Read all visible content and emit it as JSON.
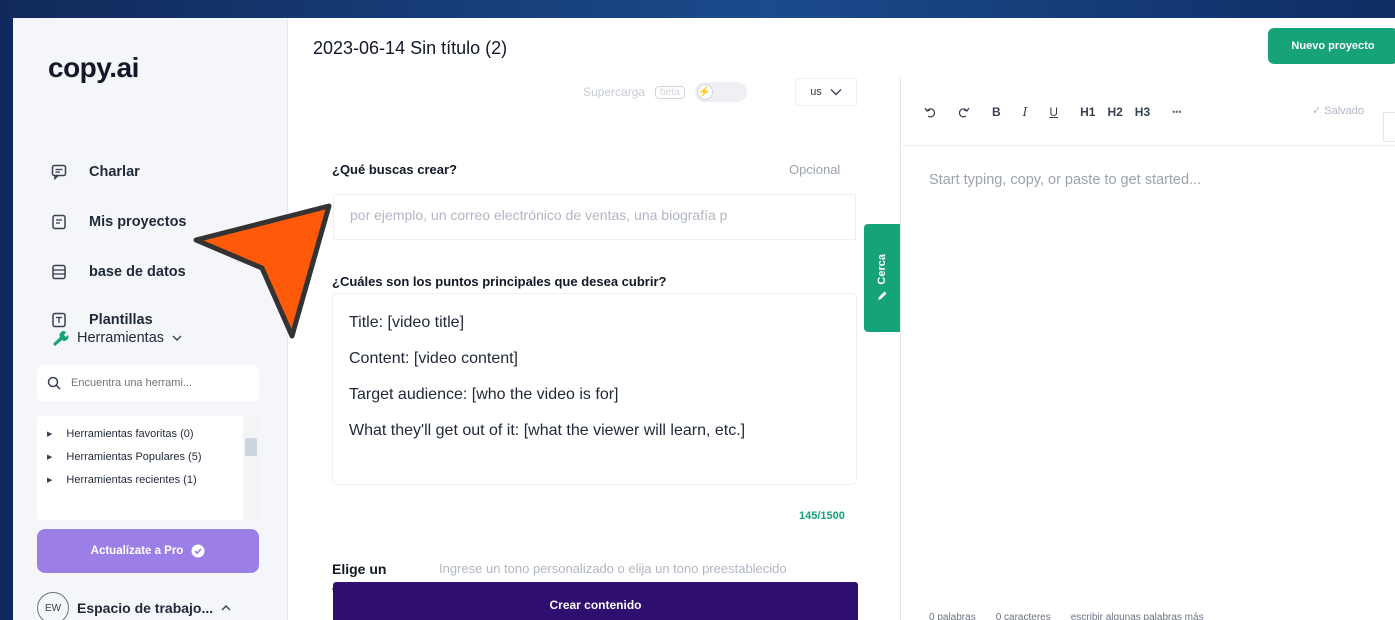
{
  "app": {
    "logo": "copy.ai",
    "doc_title": "2023-06-14 Sin título (2)",
    "new_project_label": "Nuevo proyecto"
  },
  "sidebar": {
    "items": [
      {
        "label": "Charlar",
        "icon": "chat-icon"
      },
      {
        "label": "Mis proyectos",
        "icon": "file-icon"
      },
      {
        "label": "base de datos",
        "icon": "database-icon"
      },
      {
        "label": "Plantillas",
        "icon": "template-icon"
      }
    ],
    "tools_label": "Herramientas",
    "search_placeholder": "Encuentra una herrami...",
    "tree": [
      "Herramientas favoritas (0)",
      "Herramientas Populares (5)",
      "Herramientas recientes (1)"
    ],
    "upgrade_label": "Actualízate a Pro",
    "workspace_avatar": "EW",
    "workspace_name": "Espacio de trabajo..."
  },
  "form": {
    "supercharge_label": "Supercarga",
    "beta_label": "beta",
    "language": "us",
    "q1_label": "¿Qué buscas crear?",
    "q1_optional": "Opcional",
    "q1_placeholder": "por ejemplo, un correo electrónico de ventas, una biografía p",
    "q2_label": "¿Cuáles son los puntos principales que desea cubrir?",
    "q2_lines": [
      "Title: [video title]",
      "Content: [video content]",
      "Target audience: [who the video is for]",
      "What they'll get out of it: [what the viewer will learn, etc.]"
    ],
    "counter": "145/1500",
    "tone_label": "Elige un tono",
    "tone_placeholder": "Ingrese un tono personalizado o elija un tono preestablecido",
    "create_label": "Crear contenido",
    "side_tab_label": "Cerca"
  },
  "editor": {
    "toolbar": {
      "bold": "B",
      "italic": "I",
      "underline": "U",
      "h1": "H1",
      "h2": "H2",
      "h3": "H3",
      "more": "•••"
    },
    "saved_label": "✓ Salvado",
    "placeholder": "Start typing, copy, or paste to get started...",
    "footer": [
      "0 palabras",
      "0 caracteres",
      "escribir algunas palabras más"
    ]
  },
  "colors": {
    "accent_green": "#16a37a",
    "create_button": "#2e0e6e",
    "upgrade_button": "#9b7fe6",
    "pointer_arrow": "#ff5a0a"
  }
}
